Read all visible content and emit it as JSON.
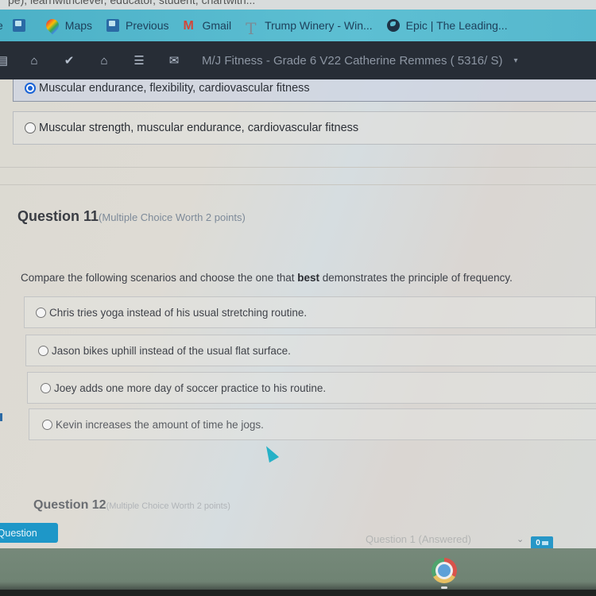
{
  "url_sliver_text": "pe), learnwithclever, educator, student, chartwith...",
  "bookmarks": [
    {
      "icon": "classroom-icon",
      "label": ""
    },
    {
      "icon": "maps-pin-icon",
      "label": "Maps"
    },
    {
      "icon": "classroom-icon",
      "label": "Previous"
    },
    {
      "icon": "gmail-icon",
      "label": "Gmail"
    },
    {
      "icon": "trump-winery-icon",
      "label": "Trump Winery - Win..."
    },
    {
      "icon": "globe-icon",
      "label": "Epic | The Leading..."
    }
  ],
  "bookmark_first_partial": "e",
  "appbar": {
    "icons": [
      "calendar-icon",
      "inbox-icon",
      "checkmark-icon",
      "home-icon",
      "menu-icon",
      "mail-icon"
    ],
    "course_title": "M/J Fitness - Grade 6 V22  Catherine Remmes ( 5316/ S)",
    "caret": "▾"
  },
  "previous_question": {
    "options": [
      {
        "label": "Muscular endurance, flexibility, cardiovascular fitness",
        "selected": true
      },
      {
        "label": "Muscular strength, muscular endurance, cardiovascular fitness",
        "selected": false
      }
    ]
  },
  "question": {
    "title": "Question 11",
    "meta": "(Multiple Choice Worth 2 points)",
    "prompt_before": "Compare the following scenarios and choose the one that ",
    "prompt_bold": "best",
    "prompt_after": " demonstrates the principle of frequency.",
    "options": [
      {
        "label": "Chris tries yoga instead of his usual stretching routine.",
        "selected": false
      },
      {
        "label": "Jason bikes uphill instead of the usual flat surface.",
        "selected": false
      },
      {
        "label": "Joey adds one more day of soccer practice to his routine.",
        "selected": false
      },
      {
        "label": "Kevin increases the amount of time he jogs.",
        "selected": false
      }
    ]
  },
  "next_question": {
    "title": "Question 12",
    "meta": "(Multiple Choice Worth 2 points)"
  },
  "footer": {
    "previous_button": "us Question",
    "question_select_value": "Question 1 (Answered)",
    "select_caret": "⌄",
    "flag_count": "0"
  },
  "colors": {
    "bookmark_bar": "#5dbfd3",
    "appbar": "#272d36",
    "accent": "#1e97c8",
    "radio_selected": "#1a63d6"
  }
}
